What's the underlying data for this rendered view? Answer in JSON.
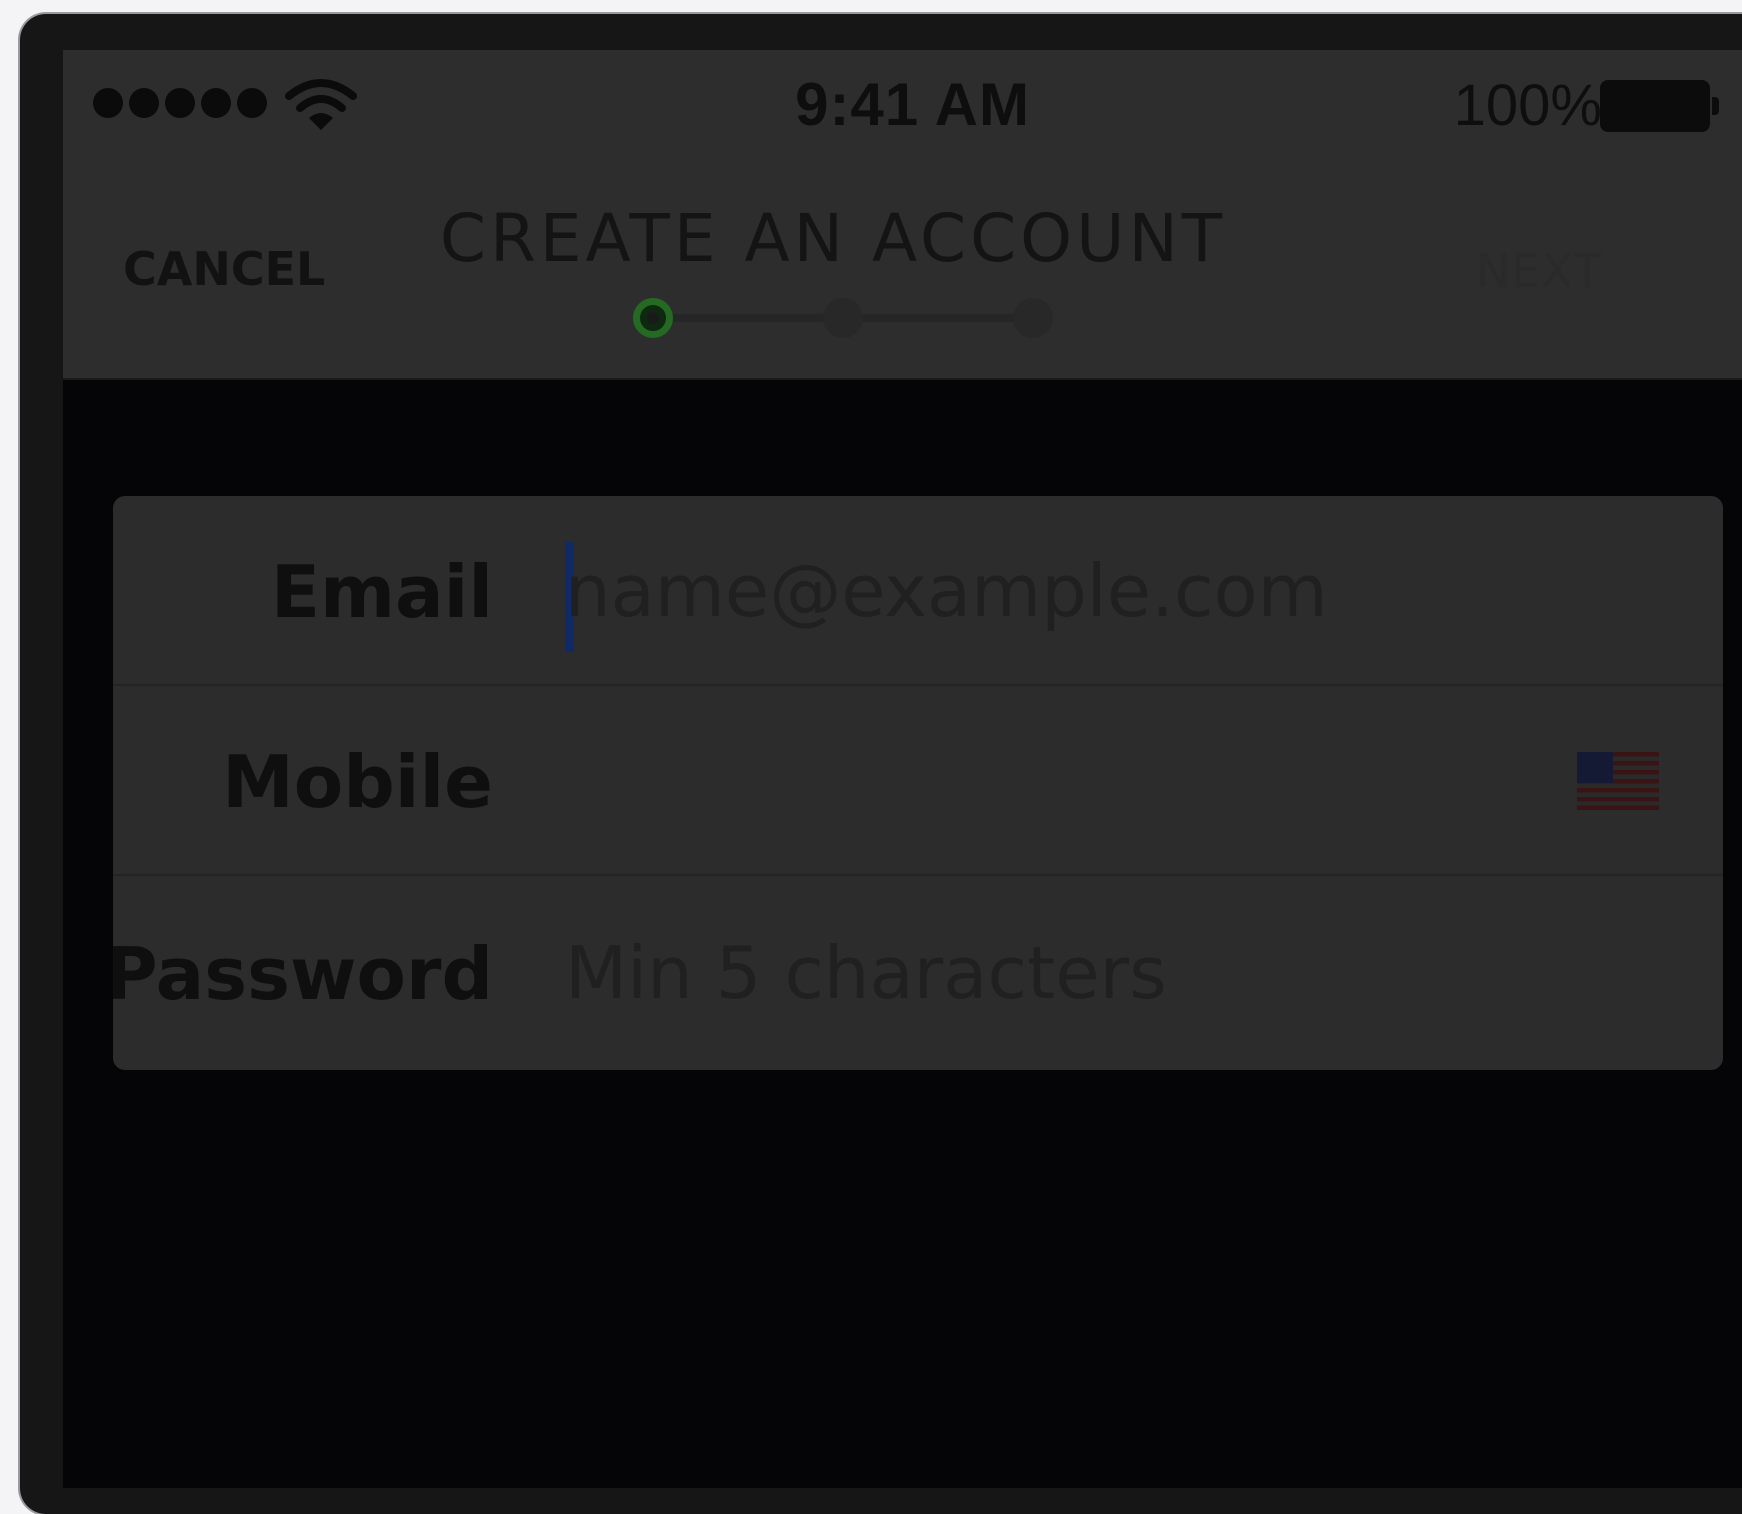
{
  "status_bar": {
    "time": "9:41 AM",
    "battery_percent": "100%",
    "signal_dots": 5,
    "battery_level": 1.0
  },
  "nav": {
    "cancel_label": "CANCEL",
    "title": "CREATE AN ACCOUNT",
    "next_label": "NEXT",
    "steps_total": 3,
    "current_step": 1
  },
  "form": {
    "email": {
      "label": "Email",
      "placeholder": "name@example.com",
      "value": ""
    },
    "mobile": {
      "label": "Mobile",
      "placeholder": "",
      "value": "",
      "country_icon": "us-flag-icon"
    },
    "password": {
      "label": "Password",
      "placeholder": "Min 5 characters",
      "value": ""
    }
  },
  "colors": {
    "progress_active": "#246a22",
    "caret": "#0f2a66"
  }
}
